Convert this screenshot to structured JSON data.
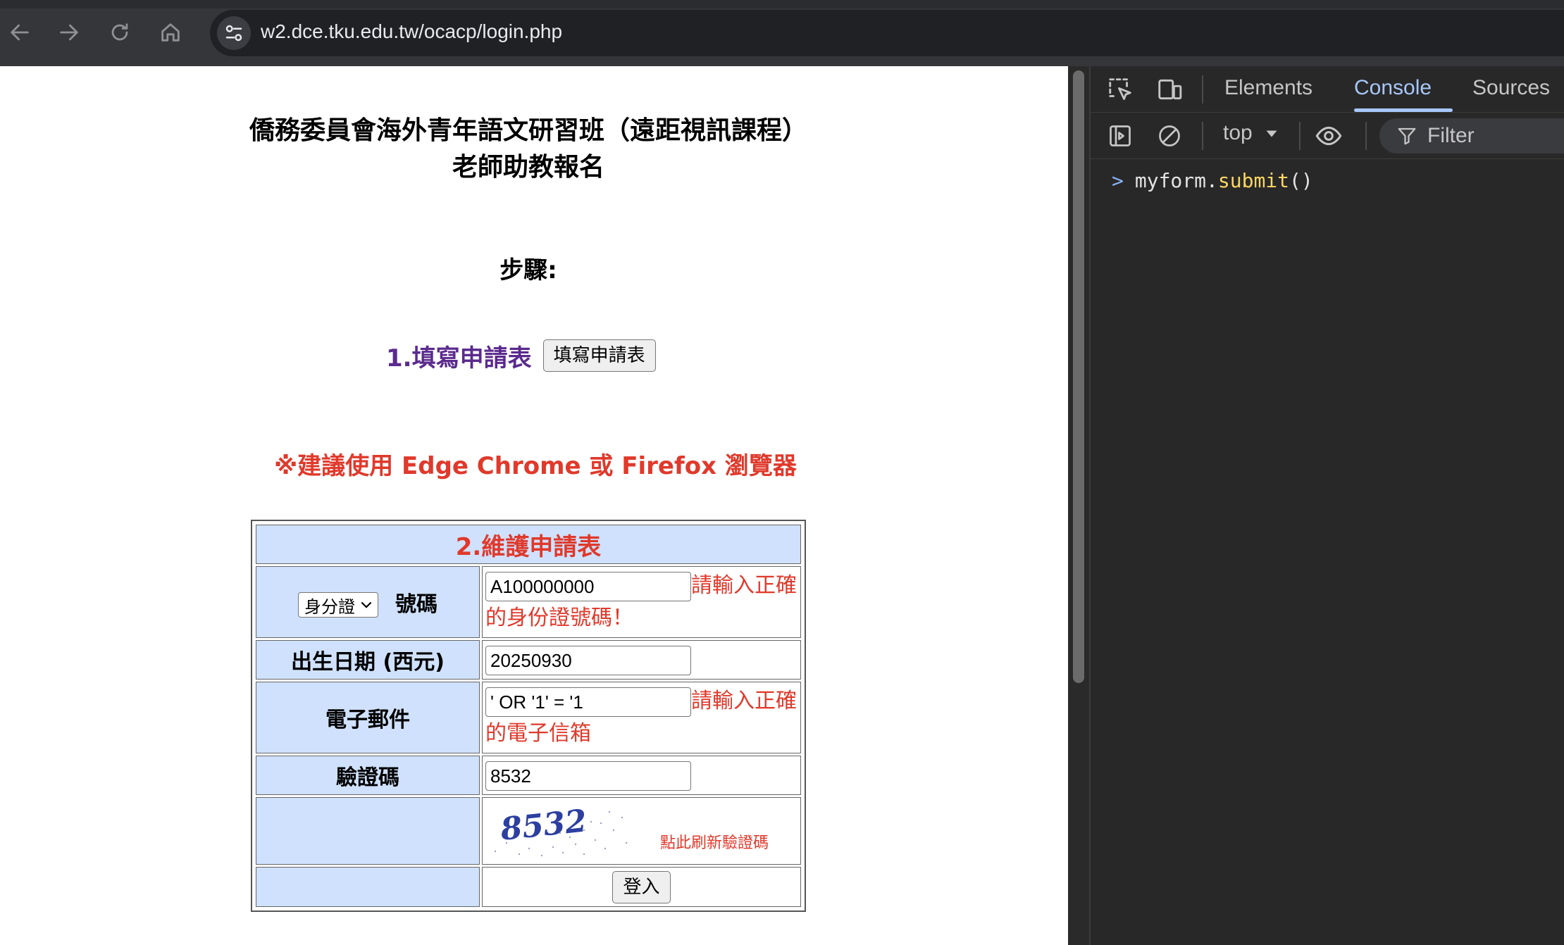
{
  "browser": {
    "url": "w2.dce.tku.edu.tw/ocacp/login.php"
  },
  "page": {
    "title": "僑務委員會海外青年語文研習班（遠距視訊課程）老師助教報名",
    "steps_heading": "步驟:",
    "step1": {
      "label": "1.填寫申請表",
      "button": "填寫申請表"
    },
    "browser_note": "※建議使用 Edge Chrome 或 Firefox 瀏覽器",
    "form": {
      "header": "2.維護申請表",
      "id_type": {
        "selected": "身分證",
        "label": "號碼"
      },
      "id_value": "A100000000",
      "id_error": "請輸入正確的身份證號碼！",
      "birth_label": "出生日期 (西元)",
      "birth_value": "20250930",
      "email_label": "電子郵件",
      "email_value": "' OR '1' = '1",
      "email_error": "請輸入正確的電子信箱",
      "captcha_label": "驗證碼",
      "captcha_value": "8532",
      "captcha_image_text": "8532",
      "refresh_link": "點此刷新驗證碼",
      "login_button": "登入"
    }
  },
  "devtools": {
    "tabs": [
      "Elements",
      "Console",
      "Sources"
    ],
    "active_tab": "Console",
    "context": "top",
    "filter_placeholder": "Filter",
    "console": {
      "object": "myform.",
      "method": "submit",
      "args": "()"
    }
  },
  "colors": {
    "accent_red": "#e0392b",
    "step_purple": "#5b2a8e",
    "table_label_bg": "#cfe1fd",
    "devtools_active": "#a8c7fa"
  }
}
